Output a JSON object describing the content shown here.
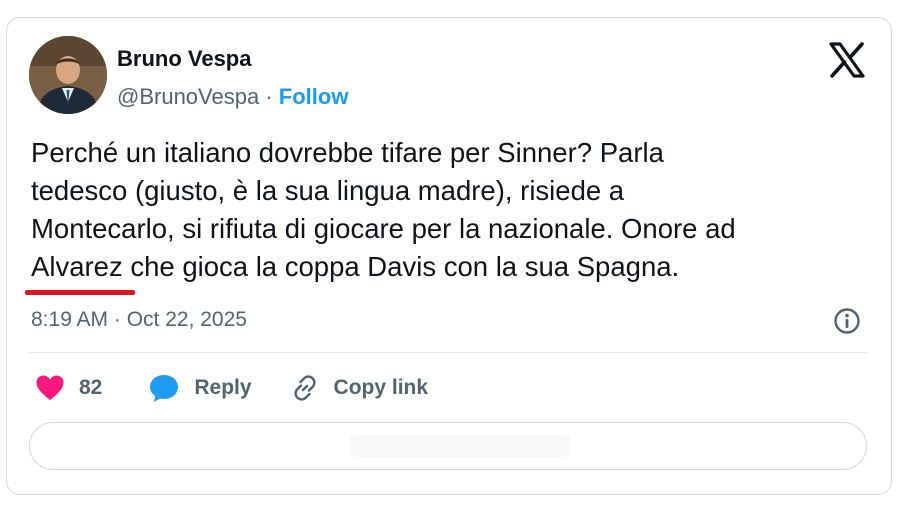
{
  "author": {
    "display_name": "Bruno Vespa",
    "handle": "@BrunoVespa",
    "separator": "·",
    "follow_label": "Follow"
  },
  "tweet": {
    "text": "Perché un italiano dovrebbe tifare per Sinner? Parla\ntedesco (giusto, è la sua lingua madre), risiede a\nMontecarlo, si rifiuta di giocare per la nazionale. Onore ad\nAlvarez che gioca la coppa Davis con la sua Spagna.",
    "timestamp": "8:19 AM · Oct 22, 2025"
  },
  "actions": {
    "like_count": "82",
    "reply_label": "Reply",
    "copy_link_label": "Copy link"
  },
  "colors": {
    "follow": "#1d9bf0",
    "like_heart": "#f91880",
    "reply_bubble": "#1d9bf0",
    "underline": "#e0141a"
  },
  "icons": {
    "brand": "x-logo-icon",
    "info": "info-icon",
    "like": "heart-icon",
    "reply": "speech-bubble-icon",
    "copy": "link-icon"
  }
}
